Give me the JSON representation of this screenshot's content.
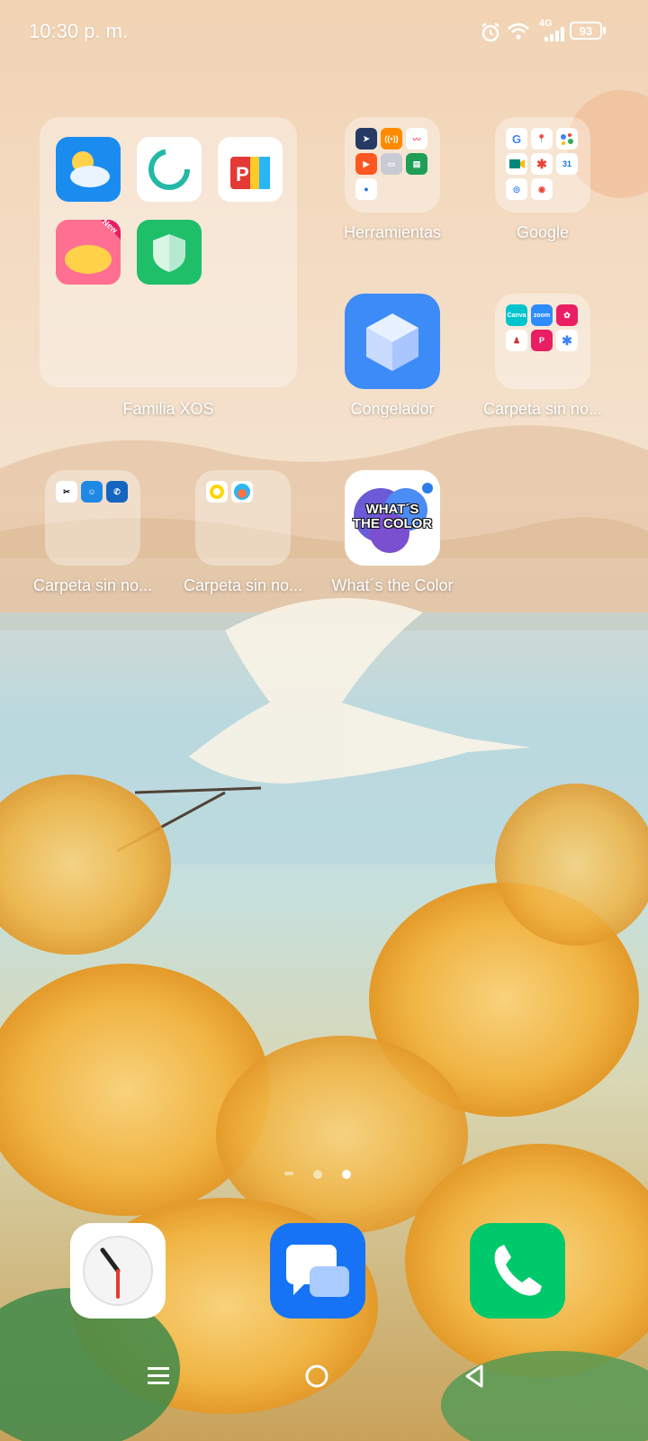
{
  "status_bar": {
    "time": "10:30 p. m.",
    "network": "4G",
    "battery": "93"
  },
  "folders": {
    "familia": {
      "label": "Familia XOS",
      "new_badge": "New"
    },
    "herramientas": {
      "label": "Herramientas"
    },
    "google": {
      "label": "Google"
    },
    "carpeta1": {
      "label": "Carpeta sin no..."
    },
    "carpeta2": {
      "label": "Carpeta sin no..."
    },
    "carpeta3": {
      "label": "Carpeta sin no..."
    }
  },
  "apps": {
    "congelador": {
      "label": "Congelador"
    },
    "whats_color": {
      "label": "What´s the Color",
      "icon_text_1": "WHAT´S",
      "icon_text_2": "THE COLOR"
    }
  },
  "mini_icons": {
    "canva": "Canva",
    "zoom": "zoom",
    "google_g": "G"
  },
  "page_indicator": {
    "pages": 2,
    "current": 2
  },
  "colors": {
    "accent_blue": "#1a73e8",
    "phone_green": "#00c96b",
    "messages_blue": "#1673f5"
  }
}
